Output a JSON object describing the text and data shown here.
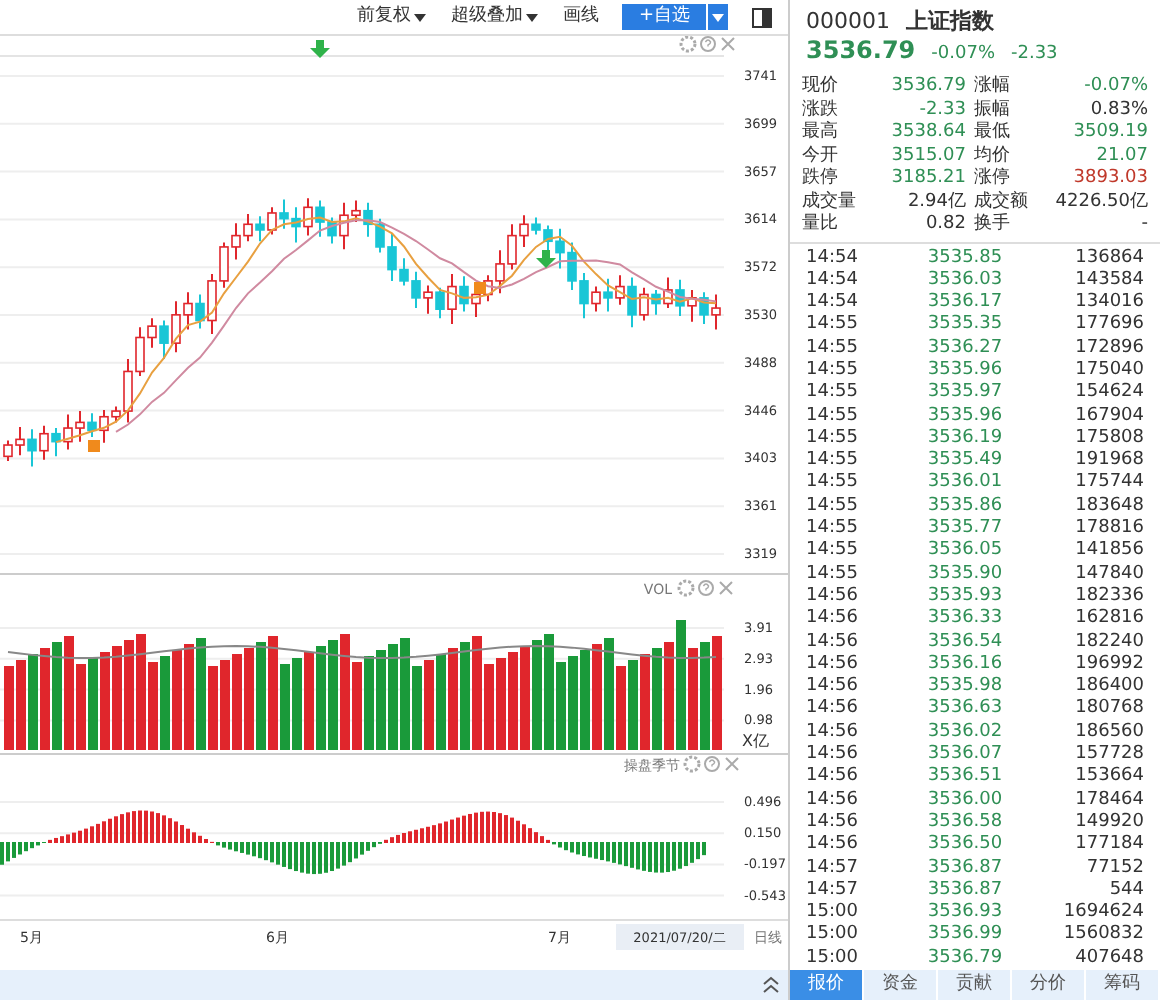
{
  "toolbar": {
    "items": [
      {
        "label": "前复权",
        "dropdown": true
      },
      {
        "label": "超级叠加",
        "dropdown": true
      },
      {
        "label": "画线",
        "dropdown": false
      }
    ],
    "add_button": "+自选"
  },
  "price_chart": {
    "y_ticks": [
      "3741",
      "3699",
      "3657",
      "3614",
      "3572",
      "3530",
      "3488",
      "3446",
      "3403",
      "3361",
      "3319"
    ]
  },
  "volume_panel": {
    "title": "VOL",
    "y_ticks": [
      "3.91",
      "2.93",
      "1.96",
      "0.98"
    ],
    "unit": "X亿"
  },
  "indicator_panel": {
    "title": "操盘季节",
    "y_ticks": [
      "0.496",
      "0.150",
      "-0.197",
      "-0.543"
    ]
  },
  "x_axis": {
    "labels": [
      "5月",
      "6月",
      "7月"
    ],
    "cursor_date": "2021/07/20/二",
    "period": "日线"
  },
  "quote": {
    "code": "000001",
    "name": "上证指数",
    "price": "3536.79",
    "change_pct": "-0.07%",
    "change": "-2.33",
    "stats": [
      {
        "label": "现价",
        "value": "3536.79",
        "color": "#2f8f55"
      },
      {
        "label": "涨幅",
        "value": "-0.07%",
        "color": "#2f8f55"
      },
      {
        "label": "涨跌",
        "value": "-2.33",
        "color": "#2f8f55"
      },
      {
        "label": "振幅",
        "value": "0.83%",
        "color": "#333333"
      },
      {
        "label": "最高",
        "value": "3538.64",
        "color": "#2f8f55"
      },
      {
        "label": "最低",
        "value": "3509.19",
        "color": "#2f8f55"
      },
      {
        "label": "今开",
        "value": "3515.07",
        "color": "#2f8f55"
      },
      {
        "label": "均价",
        "value": "21.07",
        "color": "#2f8f55"
      },
      {
        "label": "跌停",
        "value": "3185.21",
        "color": "#2f8f55"
      },
      {
        "label": "涨停",
        "value": "3893.03",
        "color": "#c0392b"
      },
      {
        "label": "成交量",
        "value": "2.94亿",
        "color": "#333333"
      },
      {
        "label": "成交额",
        "value": "4226.50亿",
        "color": "#333333"
      },
      {
        "label": "量比",
        "value": "0.82",
        "color": "#333333"
      },
      {
        "label": "换手",
        "value": "-"
      }
    ]
  },
  "ticks": [
    {
      "time": "14:54",
      "price": "3535.85",
      "volume": "136864"
    },
    {
      "time": "14:54",
      "price": "3536.03",
      "volume": "143584"
    },
    {
      "time": "14:54",
      "price": "3536.17",
      "volume": "134016"
    },
    {
      "time": "14:55",
      "price": "3535.35",
      "volume": "177696"
    },
    {
      "time": "14:55",
      "price": "3536.27",
      "volume": "172896"
    },
    {
      "time": "14:55",
      "price": "3535.96",
      "volume": "175040"
    },
    {
      "time": "14:55",
      "price": "3535.97",
      "volume": "154624"
    },
    {
      "time": "14:55",
      "price": "3535.96",
      "volume": "167904"
    },
    {
      "time": "14:55",
      "price": "3536.19",
      "volume": "175808"
    },
    {
      "time": "14:55",
      "price": "3535.49",
      "volume": "191968"
    },
    {
      "time": "14:55",
      "price": "3536.01",
      "volume": "175744"
    },
    {
      "time": "14:55",
      "price": "3535.86",
      "volume": "183648"
    },
    {
      "time": "14:55",
      "price": "3535.77",
      "volume": "178816"
    },
    {
      "time": "14:55",
      "price": "3536.05",
      "volume": "141856"
    },
    {
      "time": "14:55",
      "price": "3535.90",
      "volume": "147840"
    },
    {
      "time": "14:56",
      "price": "3535.93",
      "volume": "182336"
    },
    {
      "time": "14:56",
      "price": "3536.33",
      "volume": "162816"
    },
    {
      "time": "14:56",
      "price": "3536.54",
      "volume": "182240"
    },
    {
      "time": "14:56",
      "price": "3536.16",
      "volume": "196992"
    },
    {
      "time": "14:56",
      "price": "3535.98",
      "volume": "186400"
    },
    {
      "time": "14:56",
      "price": "3536.63",
      "volume": "180768"
    },
    {
      "time": "14:56",
      "price": "3536.02",
      "volume": "186560"
    },
    {
      "time": "14:56",
      "price": "3536.07",
      "volume": "157728"
    },
    {
      "time": "14:56",
      "price": "3536.51",
      "volume": "153664"
    },
    {
      "time": "14:56",
      "price": "3536.00",
      "volume": "178464"
    },
    {
      "time": "14:56",
      "price": "3536.58",
      "volume": "149920"
    },
    {
      "time": "14:56",
      "price": "3536.50",
      "volume": "177184"
    },
    {
      "time": "14:57",
      "price": "3536.87",
      "volume": "77152"
    },
    {
      "time": "14:57",
      "price": "3536.87",
      "volume": "544"
    },
    {
      "time": "15:00",
      "price": "3536.93",
      "volume": "1694624"
    },
    {
      "time": "15:00",
      "price": "3536.99",
      "volume": "1560832"
    },
    {
      "time": "15:00",
      "price": "3536.79",
      "volume": "407648"
    }
  ],
  "tabs": [
    {
      "label": "报价",
      "selected": true
    },
    {
      "label": "资金",
      "selected": false
    },
    {
      "label": "贡献",
      "selected": false
    },
    {
      "label": "分价",
      "selected": false
    },
    {
      "label": "筹码",
      "selected": false
    }
  ]
}
